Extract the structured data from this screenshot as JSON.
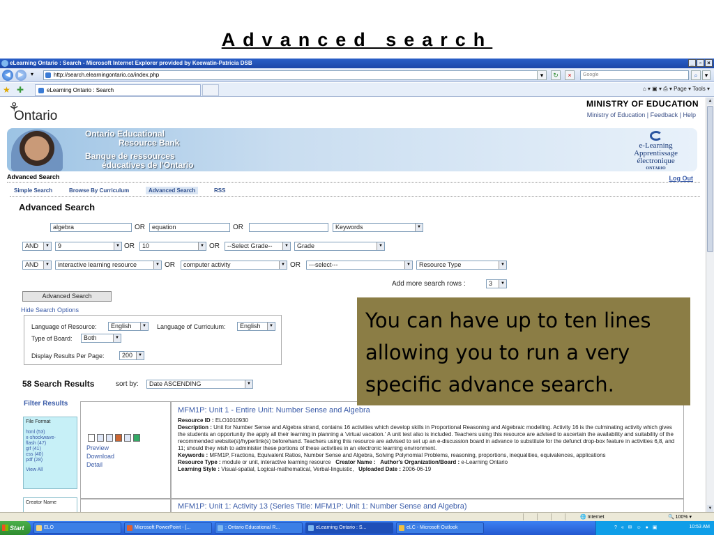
{
  "slide": {
    "title": "Advanced search",
    "callout": "You can have up to ten lines allowing you to run a very specific advance search."
  },
  "browser": {
    "window_title": "eLearning Ontario : Search - Microsoft Internet Explorer provided by Keewatin-Patricia DSB",
    "url": "http://search.elearningontario.ca/index.php",
    "search_placeholder": "Google",
    "tab_label": "eLearning Ontario : Search",
    "command_bar": "Page ▾  Tools ▾",
    "status_zone": "Internet",
    "zoom": "100%"
  },
  "header": {
    "logo_text": "Ontario",
    "ministry": "MINISTRY OF EDUCATION",
    "ministry_links": "Ministry of Education | Feedback | Help",
    "banner_en_1": "Ontario Educational",
    "banner_en_2": "Resource Bank",
    "banner_fr_1": "Banque de ressources",
    "banner_fr_2": "éducatives de l'Ontario",
    "elearn_1": "e-Learning",
    "elearn_2": "Apprentissage",
    "elearn_3": "électronique",
    "elearn_4": "ONTARIO"
  },
  "nav": {
    "section_title": "Advanced Search",
    "logout": "Log Out",
    "tabs": [
      "Simple Search",
      "Browse By Curriculum",
      "Advanced Search",
      "RSS"
    ]
  },
  "form": {
    "heading": "Advanced Search",
    "or": "OR",
    "row1": {
      "term1": "algebra",
      "term2": "equation",
      "term3": "",
      "field": "Keywords"
    },
    "row2": {
      "op": "AND",
      "v1": "9",
      "v2": "10",
      "v3": "--Select Grade--",
      "field": "Grade"
    },
    "row3": {
      "op": "AND",
      "v1": "interactive learning resource",
      "v2": "computer activity",
      "v3": "---select---",
      "field": "Resource Type"
    },
    "add_rows_label": "Add more search rows :",
    "add_rows_value": "3",
    "submit": "Advanced Search",
    "hide_options": "Hide Search Options",
    "lang_resource_label": "Language of Resource:",
    "lang_resource_value": "English",
    "lang_curriculum_label": "Language of Curriculum:",
    "lang_curriculum_value": "English",
    "board_label": "Type of Board:",
    "board_value": "Both",
    "per_page_label": "Display Results Per Page:",
    "per_page_value": "200"
  },
  "results": {
    "count_heading": "58 Search Results",
    "sort_label": "sort by:",
    "sort_value": "Date ASCENDING",
    "filter_title": "Filter Results",
    "file_format_label": "File Format",
    "file_formats": [
      "html (53)",
      "x-shockwave-",
      "flash (47)",
      "gif (41)",
      "css (40)",
      "pdf (28)"
    ],
    "view_all": "View All",
    "creator_label": "Creator Name",
    "actions": [
      "Preview",
      "Download",
      "Detail"
    ],
    "item1": {
      "title": "MFM1P: Unit 1 - Entire Unit: Number Sense and Algebra",
      "resource_id_label": "Resource ID :",
      "resource_id": "ELO1010930",
      "description_label": "Description :",
      "description": "Unit for Number Sense and Algebra strand, contains 16 activities which develop skills in Proportional Reasoning and Algebraic modelling. Activity 16 is the culminating activity which gives the students an opportunity the apply all their learning in planning a 'virtual vacation.' A unit test also is included. Teachers using this resource are advised to ascertain the availability and suitability of the recommended website(s)/hyperlink(s) beforehand. Teachers using this resource are advised to set up an e-discussion board in advance to substitute for the defunct drop-box feature in activities 6,8, and 11; should they wish to administer these portions of these activities in an electronic learning environment.",
      "keywords_label": "Keywords :",
      "keywords": "MFM1P, Fractions, Equivalent Ratios, Number Sense and Algebra, Solving Polynomial Problems, reasoning, proportions, inequalities, equivalences, applications",
      "resource_type_label": "Resource Type :",
      "resource_type": "module or unit, interactive learning resource",
      "creator_label": "Creator Name :",
      "org_label": "Author's Organization/Board :",
      "org": "e-Learning Ontario",
      "style_label": "Learning Style :",
      "style": "Visual-spatial, Logical-mathematical, Verbal-linguistic,",
      "uploaded_label": "Uploaded Date :",
      "uploaded": "2006-06-19"
    },
    "item2_title": "MFM1P: Unit 1: Activity 13 (Series Title: MFM1P: Unit 1: Number Sense and Algebra)"
  },
  "taskbar": {
    "start": "Start",
    "tasks": [
      "ELO",
      "Microsoft PowerPoint - [...",
      ": Ontario Educational R...",
      "eLearning Ontario : S...",
      "eLC - Microsoft Outlook"
    ],
    "time": "10:53 AM"
  }
}
